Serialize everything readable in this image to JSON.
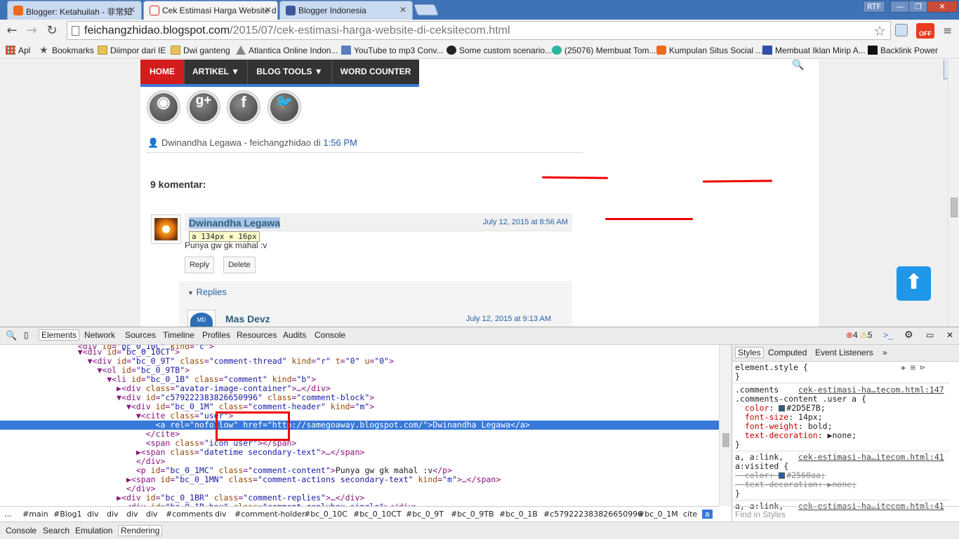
{
  "browser": {
    "tabs": [
      {
        "title": "Blogger: Ketahuilah - 非常知",
        "color": "#f0671e"
      },
      {
        "title": "Cek Estimasi Harga Website d",
        "color": "#e02020"
      },
      {
        "title": "Blogger Indonesia",
        "color": "#3b5998"
      }
    ],
    "window_buttons": [
      "RTF",
      "—",
      "❐",
      "✕"
    ],
    "url_host": "feichangzhidao.blogspot.com",
    "url_path": "/2015/07/cek-estimasi-harga-website-di-ceksitecom.html",
    "ext_off_label": "OFF"
  },
  "bookmarks": [
    {
      "label": "Apl",
      "icon": "apps-grid-icon"
    },
    {
      "label": "Bookmarks",
      "icon": "star-icon"
    },
    {
      "label": "Diimpor dari IE",
      "icon": "folder-icon"
    },
    {
      "label": "Dwi ganteng",
      "icon": "folder-icon"
    },
    {
      "label": "Atlantica Online Indon...",
      "icon": "site-icon"
    },
    {
      "label": "YouTube to mp3 Conv...",
      "icon": "site-icon"
    },
    {
      "label": "Some custom scenario...",
      "icon": "site-icon"
    },
    {
      "label": "(25076) Membuat Tom...",
      "icon": "site-icon"
    },
    {
      "label": "Kumpulan Situs Social ...",
      "icon": "blogger-icon"
    },
    {
      "label": "Membuat Iklan Mirip A...",
      "icon": "site-icon"
    },
    {
      "label": "Backlink Power",
      "icon": "site-icon"
    }
  ],
  "page": {
    "nav": [
      "HOME",
      "ARTIKEL",
      "BLOG TOOLS",
      "WORD COUNTER"
    ],
    "author": "Dwinandha Legawa - feichangzhidao",
    "at_word": "di",
    "time": "1:56 PM",
    "comments_title": "9 komentar:",
    "comment": {
      "user": "Dwinandha Legawa",
      "date": "July 12, 2015 at 8:56 AM",
      "text": "Punya gw gk mahal :v",
      "tooltip": "a  134px  ×  16px",
      "reply_btn": "Reply",
      "delete_btn": "Delete"
    },
    "replies_label": "Replies",
    "reply": {
      "user": "Mas Devz",
      "date": "July 12, 2015 at 9:13 AM",
      "avatar_text": "MD"
    }
  },
  "devtools": {
    "tabs": [
      "Elements",
      "Network",
      "Sources",
      "Timeline",
      "Profiles",
      "Resources",
      "Audits",
      "Console"
    ],
    "errors": "4",
    "warnings": "5",
    "styles_tabs": [
      "Styles",
      "Computed",
      "Event Listeners"
    ],
    "find_placeholder": "Find in Styles",
    "crumbs": [
      "#main",
      "#Blog1",
      "div",
      "div",
      "div",
      "div",
      "#comments",
      "div",
      "#comment-holder",
      "#bc_0_10C",
      "#bc_0_10CT",
      "#bc_0_9T",
      "#bc_0_9TB",
      "#bc_0_1B",
      "#c579222383826650996",
      "#bc_0_1M",
      "cite",
      "a"
    ],
    "drawer": [
      "Console",
      "Search",
      "Emulation",
      "Rendering"
    ]
  }
}
